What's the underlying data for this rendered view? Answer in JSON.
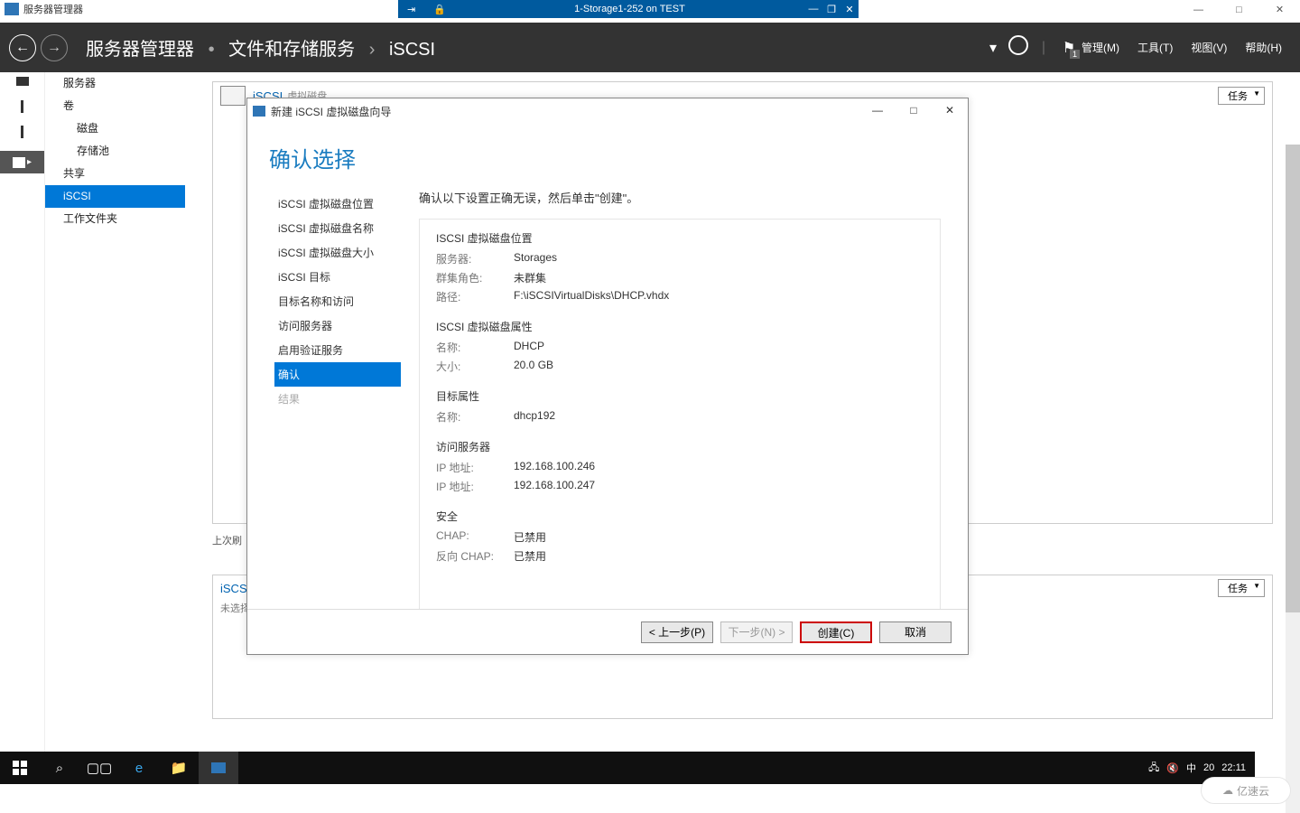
{
  "host": {
    "app_title": "服务器管理器",
    "vm_title": "1-Storage1-252 on TEST",
    "min": "—",
    "max": "□",
    "close": "✕"
  },
  "smheader": {
    "crumb1": "服务器管理器",
    "crumb2": "文件和存储服务",
    "crumb3": "iSCSI",
    "menu_manage": "管理(M)",
    "menu_tools": "工具(T)",
    "menu_view": "视图(V)",
    "menu_help": "帮助(H)",
    "flag_badge": "1"
  },
  "sidebar": {
    "items": [
      {
        "label": "服务器"
      },
      {
        "label": "卷"
      },
      {
        "label": "磁盘",
        "indent": true
      },
      {
        "label": "存储池",
        "indent": true
      },
      {
        "label": "共享"
      },
      {
        "label": "iSCSI",
        "active": true
      },
      {
        "label": "工作文件夹"
      }
    ]
  },
  "panels": {
    "top_title": "iSCSI",
    "top_sub": "虚拟磁盘",
    "tasks": "任务",
    "last_refresh": "上次刷",
    "bottom_title": "iSCSI",
    "bottom_sub": "未选择"
  },
  "wizard": {
    "title": "新建 iSCSI 虚拟磁盘向导",
    "heading": "确认选择",
    "instruction": "确认以下设置正确无误，然后单击\"创建\"。",
    "steps": [
      {
        "label": "iSCSI 虚拟磁盘位置"
      },
      {
        "label": "iSCSI 虚拟磁盘名称"
      },
      {
        "label": "iSCSI 虚拟磁盘大小"
      },
      {
        "label": "iSCSI 目标"
      },
      {
        "label": "目标名称和访问"
      },
      {
        "label": "访问服务器"
      },
      {
        "label": "启用验证服务"
      },
      {
        "label": "确认",
        "active": true
      },
      {
        "label": "结果",
        "disabled": true
      }
    ],
    "sections": {
      "loc_title": "ISCSI 虚拟磁盘位置",
      "server_lbl": "服务器:",
      "server_val": "Storages",
      "role_lbl": "群集角色:",
      "role_val": "未群集",
      "path_lbl": "路径:",
      "path_val": "F:\\iSCSIVirtualDisks\\DHCP.vhdx",
      "attr_title": "ISCSI 虚拟磁盘属性",
      "name_lbl": "名称:",
      "name_val": "DHCP",
      "size_lbl": "大小:",
      "size_val": "20.0 GB",
      "target_title": "目标属性",
      "tname_lbl": "名称:",
      "tname_val": "dhcp192",
      "access_title": "访问服务器",
      "ip1_lbl": "IP 地址:",
      "ip1_val": "192.168.100.246",
      "ip2_lbl": "IP 地址:",
      "ip2_val": "192.168.100.247",
      "sec_title": "安全",
      "chap_lbl": "CHAP:",
      "chap_val": "已禁用",
      "rchap_lbl": "反向 CHAP:",
      "rchap_val": "已禁用"
    },
    "buttons": {
      "prev": "< 上一步(P)",
      "next": "下一步(N) >",
      "create": "创建(C)",
      "cancel": "取消"
    },
    "win": {
      "min": "—",
      "max": "□",
      "close": "✕"
    }
  },
  "tray": {
    "time": "22:11",
    "extra": "20",
    "ime": "中"
  },
  "watermark": "亿速云"
}
